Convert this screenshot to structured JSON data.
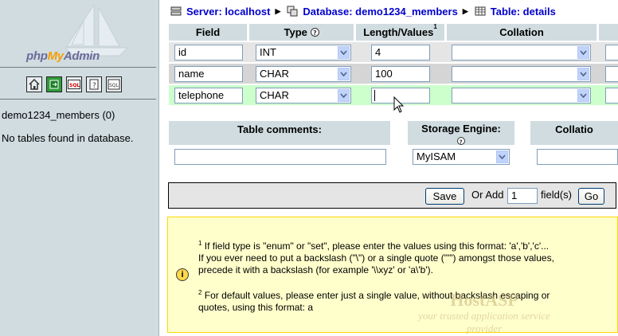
{
  "left": {
    "logo": {
      "php": "php",
      "my": "My",
      "admin": "Admin"
    },
    "nav_icons": [
      "home-icon",
      "exit-icon",
      "sql-query-icon",
      "docs-icon",
      "sql-docs-icon"
    ],
    "db_link": "demo1234_members (0)",
    "no_tables": "No tables found in database."
  },
  "breadcrumb": {
    "server": "Server: localhost",
    "database": "Database: demo1234_members",
    "table": "Table: details"
  },
  "columns": {
    "field": "Field",
    "type": "Type",
    "length": "Length/Values",
    "length_sup": "1",
    "collation": "Collation"
  },
  "rows": [
    {
      "field": "id",
      "type": "INT",
      "length": "4",
      "collation": ""
    },
    {
      "field": "name",
      "type": "CHAR",
      "length": "100",
      "collation": ""
    },
    {
      "field": "telephone",
      "type": "CHAR",
      "length": "",
      "collation": ""
    }
  ],
  "table_options": {
    "comments_label": "Table comments:",
    "comments_value": "",
    "engine_label": "Storage Engine:",
    "engine_value": "MyISAM",
    "collation_label": "Collatio"
  },
  "save_bar": {
    "save_label": "Save",
    "or_add": "Or Add",
    "add_count": "1",
    "fields_label": "field(s)",
    "go_label": "Go"
  },
  "notes": {
    "n1_sup": "1",
    "n1_line1": "If field type is \"enum\" or \"set\", please enter the values using this format: 'a','b','c'...",
    "n1_line2": "If you ever need to put a backslash (\"\\\") or a single quote (\"'\") amongst those values,",
    "n1_line3": "precede it with a backslash (for example '\\\\xyz' or 'a\\'b').",
    "n2_sup": "2",
    "n2_line1": "For default values, please enter just a single value, without backslash escaping or",
    "n2_line2": "quotes, using this format: a"
  },
  "watermark": {
    "brand": "HostASP",
    "tagline": "your trusted application service provider"
  },
  "colors": {
    "header_bg": "#d0dce0",
    "link": "#0000cc",
    "highlight_row": "#ccffcc",
    "notice_bg": "#ffffcc"
  }
}
